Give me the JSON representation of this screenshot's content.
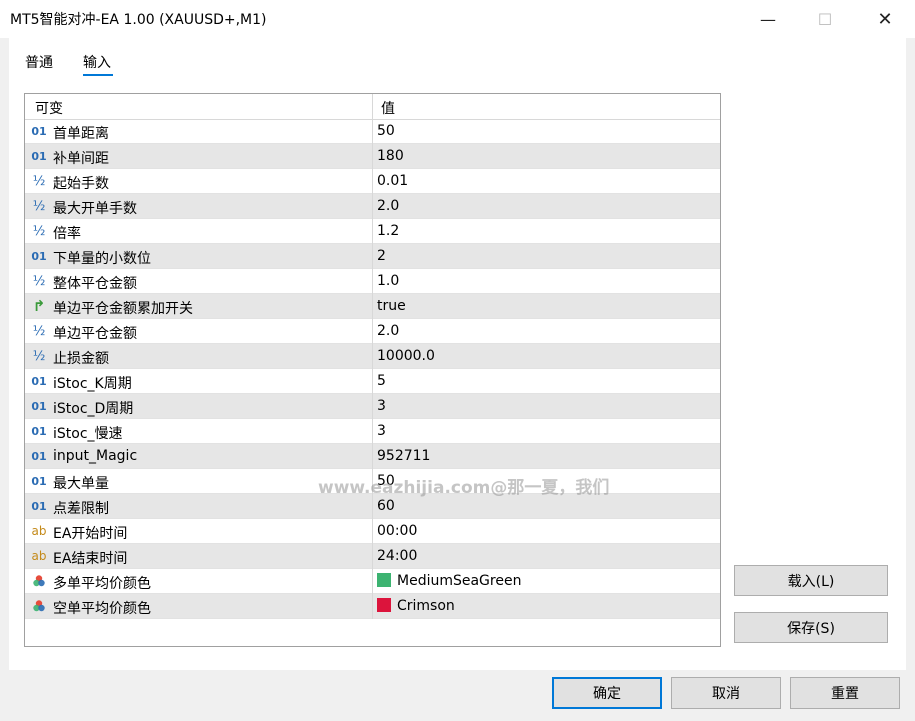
{
  "window": {
    "title": "MT5智能对冲-EA 1.00 (XAUUSD+,M1)",
    "minimize": "—",
    "maximize": "☐",
    "close": "✕"
  },
  "tabs": [
    {
      "label": "普通",
      "selected": false
    },
    {
      "label": "输入",
      "selected": true
    }
  ],
  "grid": {
    "headers": {
      "variable": "可变",
      "value": "值"
    },
    "rows": [
      {
        "icon": "01",
        "name": "首单距离",
        "value": "50"
      },
      {
        "icon": "01",
        "name": "补单间距",
        "value": "180"
      },
      {
        "icon": "½",
        "name": "起始手数",
        "value": "0.01"
      },
      {
        "icon": "½",
        "name": "最大开单手数",
        "value": "2.0"
      },
      {
        "icon": "½",
        "name": "倍率",
        "value": "1.2"
      },
      {
        "icon": "01",
        "name": "下单量的小数位",
        "value": "2"
      },
      {
        "icon": "½",
        "name": "整体平仓金额",
        "value": "1.0"
      },
      {
        "icon": "↱",
        "name": "单边平仓金额累加开关",
        "value": "true"
      },
      {
        "icon": "½",
        "name": "单边平仓金额",
        "value": "2.0"
      },
      {
        "icon": "½",
        "name": "止损金额",
        "value": "10000.0"
      },
      {
        "icon": "01",
        "name": "iStoc_K周期",
        "value": "5"
      },
      {
        "icon": "01",
        "name": "iStoc_D周期",
        "value": "3"
      },
      {
        "icon": "01",
        "name": "iStoc_慢速",
        "value": "3"
      },
      {
        "icon": "01",
        "name": "input_Magic",
        "value": "952711"
      },
      {
        "icon": "01",
        "name": "最大单量",
        "value": "50"
      },
      {
        "icon": "01",
        "name": "点差限制",
        "value": "60"
      },
      {
        "icon": "ab",
        "name": "EA开始时间",
        "value": "00:00"
      },
      {
        "icon": "ab",
        "name": "EA结束时间",
        "value": "24:00"
      },
      {
        "icon": "color",
        "name": "多单平均价颜色",
        "value": "MediumSeaGreen",
        "swatch": "#3cb371"
      },
      {
        "icon": "color",
        "name": "空单平均价颜色",
        "value": "Crimson",
        "swatch": "#dc143c"
      }
    ]
  },
  "side_buttons": {
    "load": "载入(L)",
    "save": "保存(S)"
  },
  "dialog_buttons": {
    "ok": "确定",
    "cancel": "取消",
    "reset": "重置"
  },
  "watermark": "www.eazhijia.com@那一夏，我们",
  "colors": {
    "accent": "#0078d7",
    "row_alt": "#e6e6e6",
    "icon_blue": "#2a6bb3",
    "icon_string": "#c48a1a"
  }
}
